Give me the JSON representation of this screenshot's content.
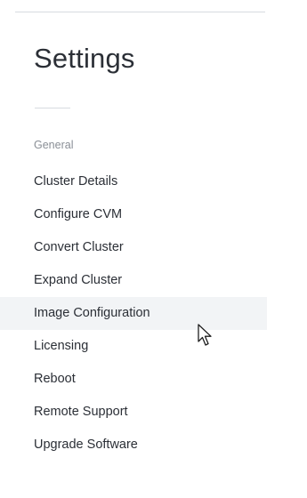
{
  "settings": {
    "title": "Settings",
    "section_label": "General",
    "items": [
      {
        "label": "Cluster Details"
      },
      {
        "label": "Configure CVM"
      },
      {
        "label": "Convert Cluster"
      },
      {
        "label": "Expand Cluster"
      },
      {
        "label": "Image Configuration",
        "active": true
      },
      {
        "label": "Licensing"
      },
      {
        "label": "Reboot"
      },
      {
        "label": "Remote Support"
      },
      {
        "label": "Upgrade Software"
      }
    ]
  },
  "icons": {
    "pointer": "mouse-pointer-icon"
  },
  "colors": {
    "title_text": "#2b2f36",
    "section_label": "#8a8f96",
    "active_background": "#f2f4f6",
    "divider": "#d7dbe0"
  }
}
